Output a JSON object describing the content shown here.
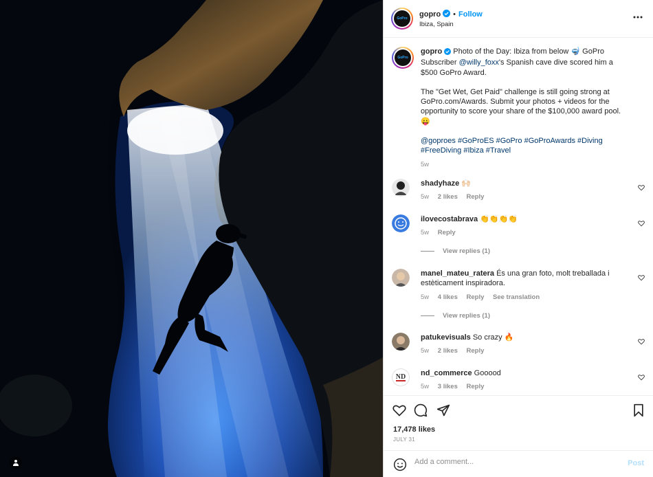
{
  "post": {
    "username": "gopro",
    "follow_label": "Follow",
    "dot": "•",
    "location": "Ibiza, Spain",
    "avatar_text": "GoPro",
    "caption": {
      "p1_a": "Photo of the Day: Ibiza from below 🤿 GoPro Subscriber ",
      "mention": "@willy_foxx",
      "p1_b": "'s Spanish cave dive scored him a $500 GoPro Award.",
      "p2": "The \"Get Wet, Get Paid\" challenge is still going strong at GoPro.com/Awards. Submit your photos + videos for the opportunity to score your share of the $100,000 award pool. 😛",
      "hashtags_line1": "@goproes #GoProES #GoPro #GoProAwards #Diving",
      "hashtags_line2": "#FreeDiving #Ibiza #Travel",
      "time": "5w"
    }
  },
  "comments": [
    {
      "username": "shadyhaze",
      "text": "🙌🏻",
      "time": "5w",
      "likes": "2 likes",
      "reply": "Reply"
    },
    {
      "username": "ilovecostabrava",
      "text": "👏👏👏👏",
      "time": "5w",
      "reply": "Reply",
      "view_replies": "View replies (1)"
    },
    {
      "username": "manel_mateu_ratera",
      "text": "És una gran foto, molt treballada i estèticament inspiradora.",
      "time": "5w",
      "likes": "4 likes",
      "reply": "Reply",
      "translate": "See translation",
      "view_replies": "View replies (1)"
    },
    {
      "username": "patukevisuals",
      "text": "So crazy 🔥",
      "time": "5w",
      "likes": "2 likes",
      "reply": "Reply"
    },
    {
      "username": "nd_commerce",
      "text": "Gooood",
      "time": "5w",
      "likes": "3 likes",
      "reply": "Reply"
    }
  ],
  "actions": {
    "likes": "17,478 likes",
    "date": "JULY 31"
  },
  "add_comment": {
    "placeholder": "Add a comment...",
    "post_label": "Post"
  },
  "icons": {
    "verified": "verified-badge-icon",
    "more": "more-options-icon",
    "like": "heart-icon",
    "comment": "comment-icon",
    "share": "share-icon",
    "save": "bookmark-icon",
    "emoji": "emoji-icon",
    "tag": "user-tag-icon"
  },
  "colors": {
    "accent": "#0095f6",
    "link": "#00376b",
    "muted": "#8e8e8e"
  }
}
